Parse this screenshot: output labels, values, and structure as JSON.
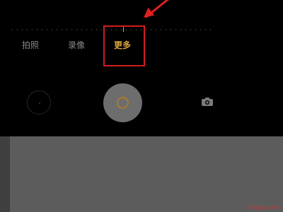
{
  "modes": [
    {
      "label": "拍照",
      "active": false
    },
    {
      "label": "录像",
      "active": false
    },
    {
      "label": "更多",
      "active": true
    }
  ],
  "colors": {
    "active_mode": "#d9a53a",
    "inactive_mode": "#8a8a8a",
    "annotation": "#d21c1c",
    "shutter": "#6d6d6d",
    "bottom_panel": "#5c5c5c"
  },
  "icons": {
    "shutter": "shutter-button",
    "switch": "camera-icon",
    "gallery": "thumbnail"
  },
  "watermark": "baogu.com"
}
